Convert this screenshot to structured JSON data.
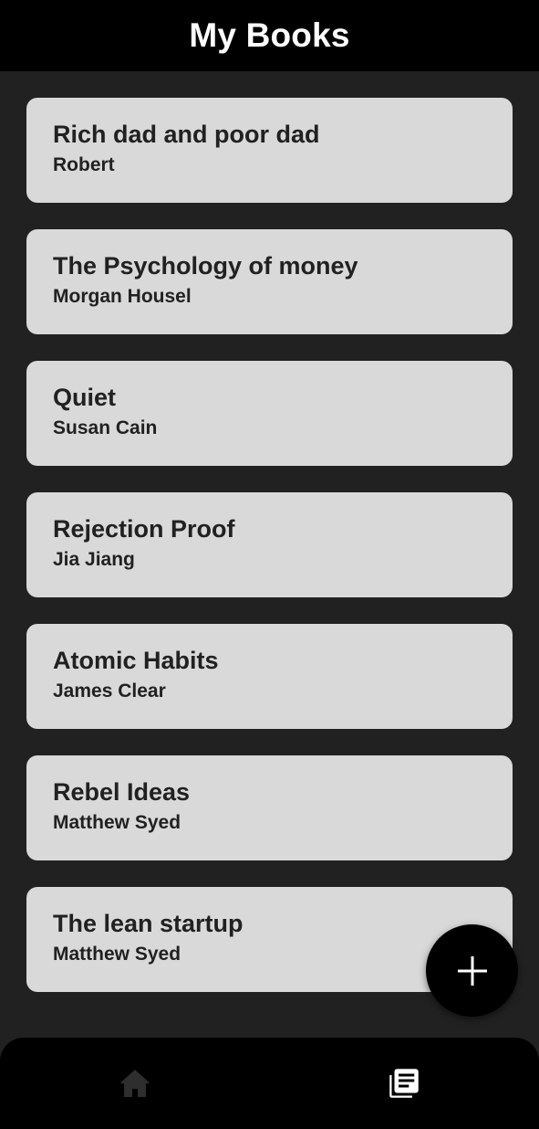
{
  "app_bar": {
    "title": "My Books"
  },
  "books": [
    {
      "title": "Rich dad and poor dad",
      "author": "Robert"
    },
    {
      "title": "The Psychology of money",
      "author": "Morgan Housel"
    },
    {
      "title": "Quiet",
      "author": "Susan Cain"
    },
    {
      "title": "Rejection Proof",
      "author": "Jia Jiang"
    },
    {
      "title": "Atomic Habits",
      "author": "James Clear"
    },
    {
      "title": "Rebel Ideas",
      "author": "Matthew Syed"
    },
    {
      "title": "The lean startup",
      "author": "Matthew Syed"
    }
  ],
  "fab": {
    "icon": "plus-icon"
  },
  "bottom_nav": {
    "items": [
      {
        "icon": "home-icon",
        "active": false
      },
      {
        "icon": "library-books-icon",
        "active": true
      }
    ]
  },
  "colors": {
    "background": "#212121",
    "bars": "#000000",
    "card": "#d9d9d9",
    "card_text": "#212121",
    "active_icon": "#ffffff",
    "inactive_icon": "#2e2e2e"
  }
}
